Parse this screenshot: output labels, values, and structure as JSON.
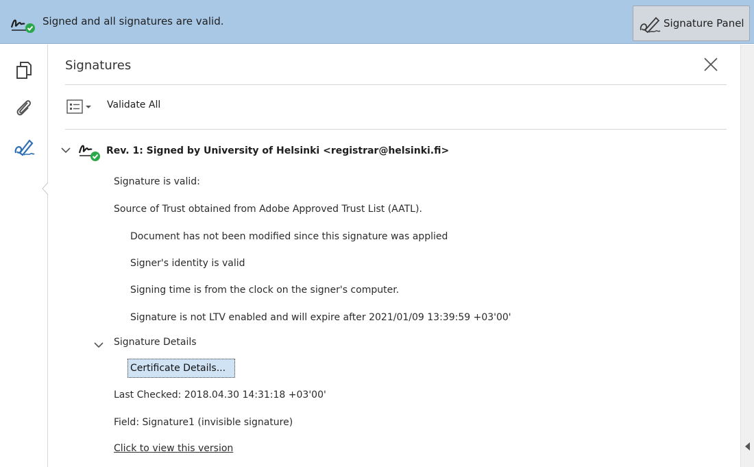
{
  "topbar": {
    "status_text": "Signed and all signatures are valid.",
    "panel_button_label": "Signature Panel",
    "accent_color": "#a9c8e6",
    "valid_color": "#2aa84a"
  },
  "panel": {
    "title": "Signatures",
    "validate_all_label": "Validate All"
  },
  "revision": {
    "title": "Rev. 1: Signed by University of Helsinki <registrar@helsinki.fi>",
    "lines": [
      "Signature is valid:",
      "Source of Trust obtained from Adobe Approved Trust List (AATL).",
      "Document has not been modified since this signature was applied",
      "Signer's identity is valid",
      "Signing time is from the clock on the signer's computer.",
      "Signature is not LTV enabled and will expire after 2021/01/09 13:39:59 +03'00'"
    ],
    "details_label": "Signature Details",
    "certificate_button": "Certificate Details...",
    "last_checked": "Last Checked: 2018.04.30 14:31:18 +03'00'",
    "field": "Field: Signature1 (invisible signature)",
    "view_version_link": "Click to view this version"
  }
}
